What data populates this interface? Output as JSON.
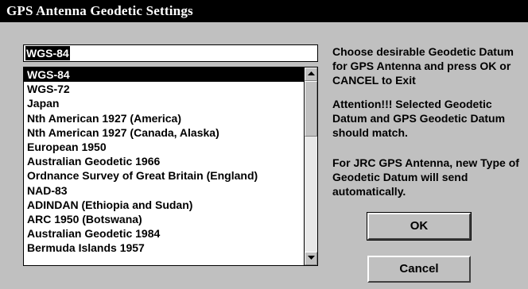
{
  "window": {
    "title": "GPS Antenna Geodetic Settings"
  },
  "datum_input": {
    "value": "WGS-84"
  },
  "datum_list": {
    "selected_index": 0,
    "items": [
      "WGS-84",
      "WGS-72",
      "Japan",
      "Nth American 1927 (America)",
      "Nth American 1927 (Canada, Alaska)",
      "European 1950",
      "Australian Geodetic 1966",
      "Ordnance Survey of Great Britain (England)",
      "NAD-83",
      "ADINDAN (Ethiopia and Sudan)",
      "ARC 1950 (Botswana)",
      "Australian Geodetic 1984",
      "Bermuda Islands 1957"
    ]
  },
  "info": {
    "instruction": "Choose desirable Geodetic Datum for GPS Antenna and press OK or CANCEL to Exit",
    "attention": "Attention!!! Selected Geodetic Datum and GPS Geodetic Datum should match.",
    "jrc_note": "For JRC GPS Antenna, new Type of Geodetic Datum will send automatically."
  },
  "buttons": {
    "ok": "OK",
    "cancel": "Cancel"
  }
}
